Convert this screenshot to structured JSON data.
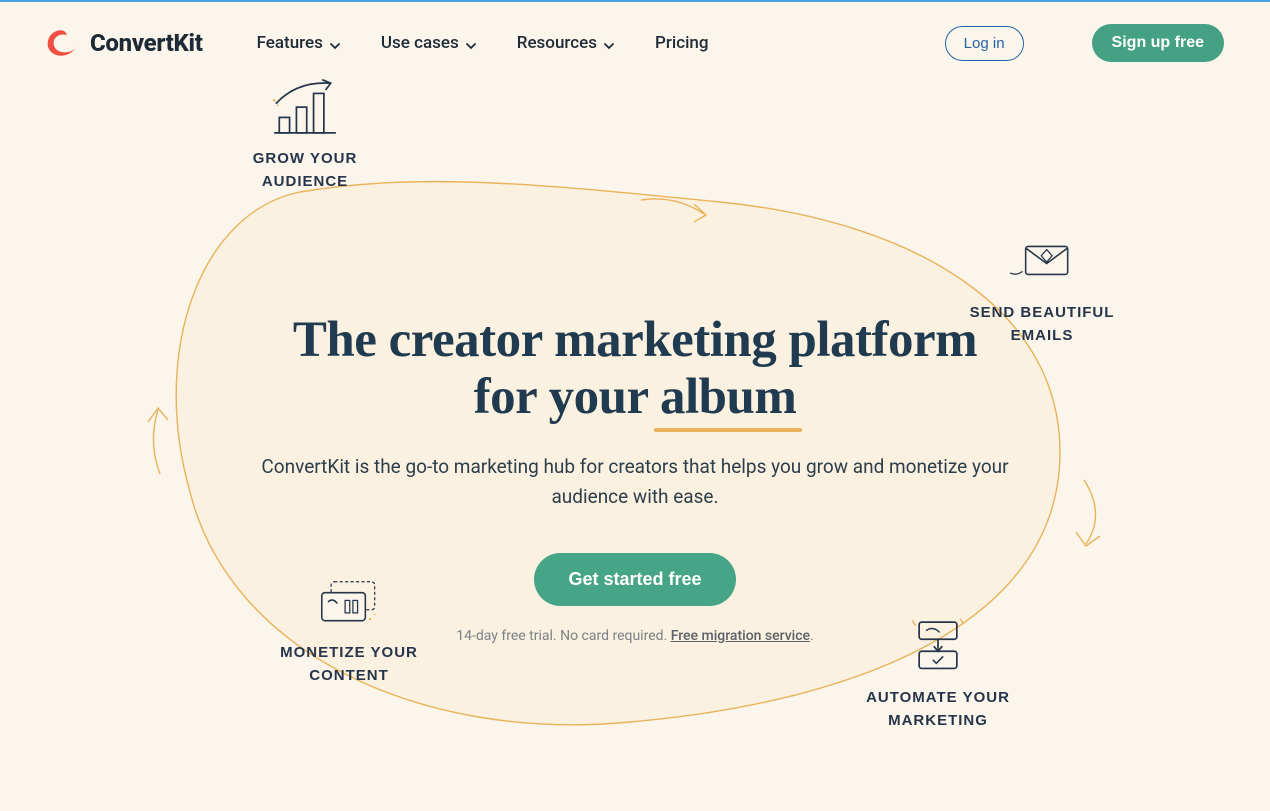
{
  "brand": {
    "name": "ConvertKit"
  },
  "nav": {
    "items": [
      {
        "label": "Features",
        "has_dropdown": true
      },
      {
        "label": "Use cases",
        "has_dropdown": true
      },
      {
        "label": "Resources",
        "has_dropdown": true
      },
      {
        "label": "Pricing",
        "has_dropdown": false
      }
    ],
    "login_label": "Log in",
    "signup_label": "Sign up free"
  },
  "hero": {
    "headline_part1": "The creator marketing platform for your ",
    "headline_rotating_word": "album",
    "subheadline": "ConvertKit is the go-to marketing hub for creators that helps you grow and monetize your audience with ease.",
    "cta_label": "Get started free",
    "trial_text": "14-day free trial. No card required. ",
    "trial_link_text": "Free migration service",
    "trial_suffix": "."
  },
  "features": {
    "grow": {
      "label": "GROW YOUR AUDIENCE"
    },
    "send": {
      "label": "SEND BEAUTIFUL EMAILS"
    },
    "money": {
      "label": "MONETIZE YOUR CONTENT"
    },
    "auto": {
      "label": "AUTOMATE YOUR MARKETING"
    }
  },
  "colors": {
    "accent_green": "#45a586",
    "brand_red": "#f04e42",
    "ink": "#203a4f",
    "sand": "#fbf5eb",
    "line_gold": "#e8b35a"
  }
}
